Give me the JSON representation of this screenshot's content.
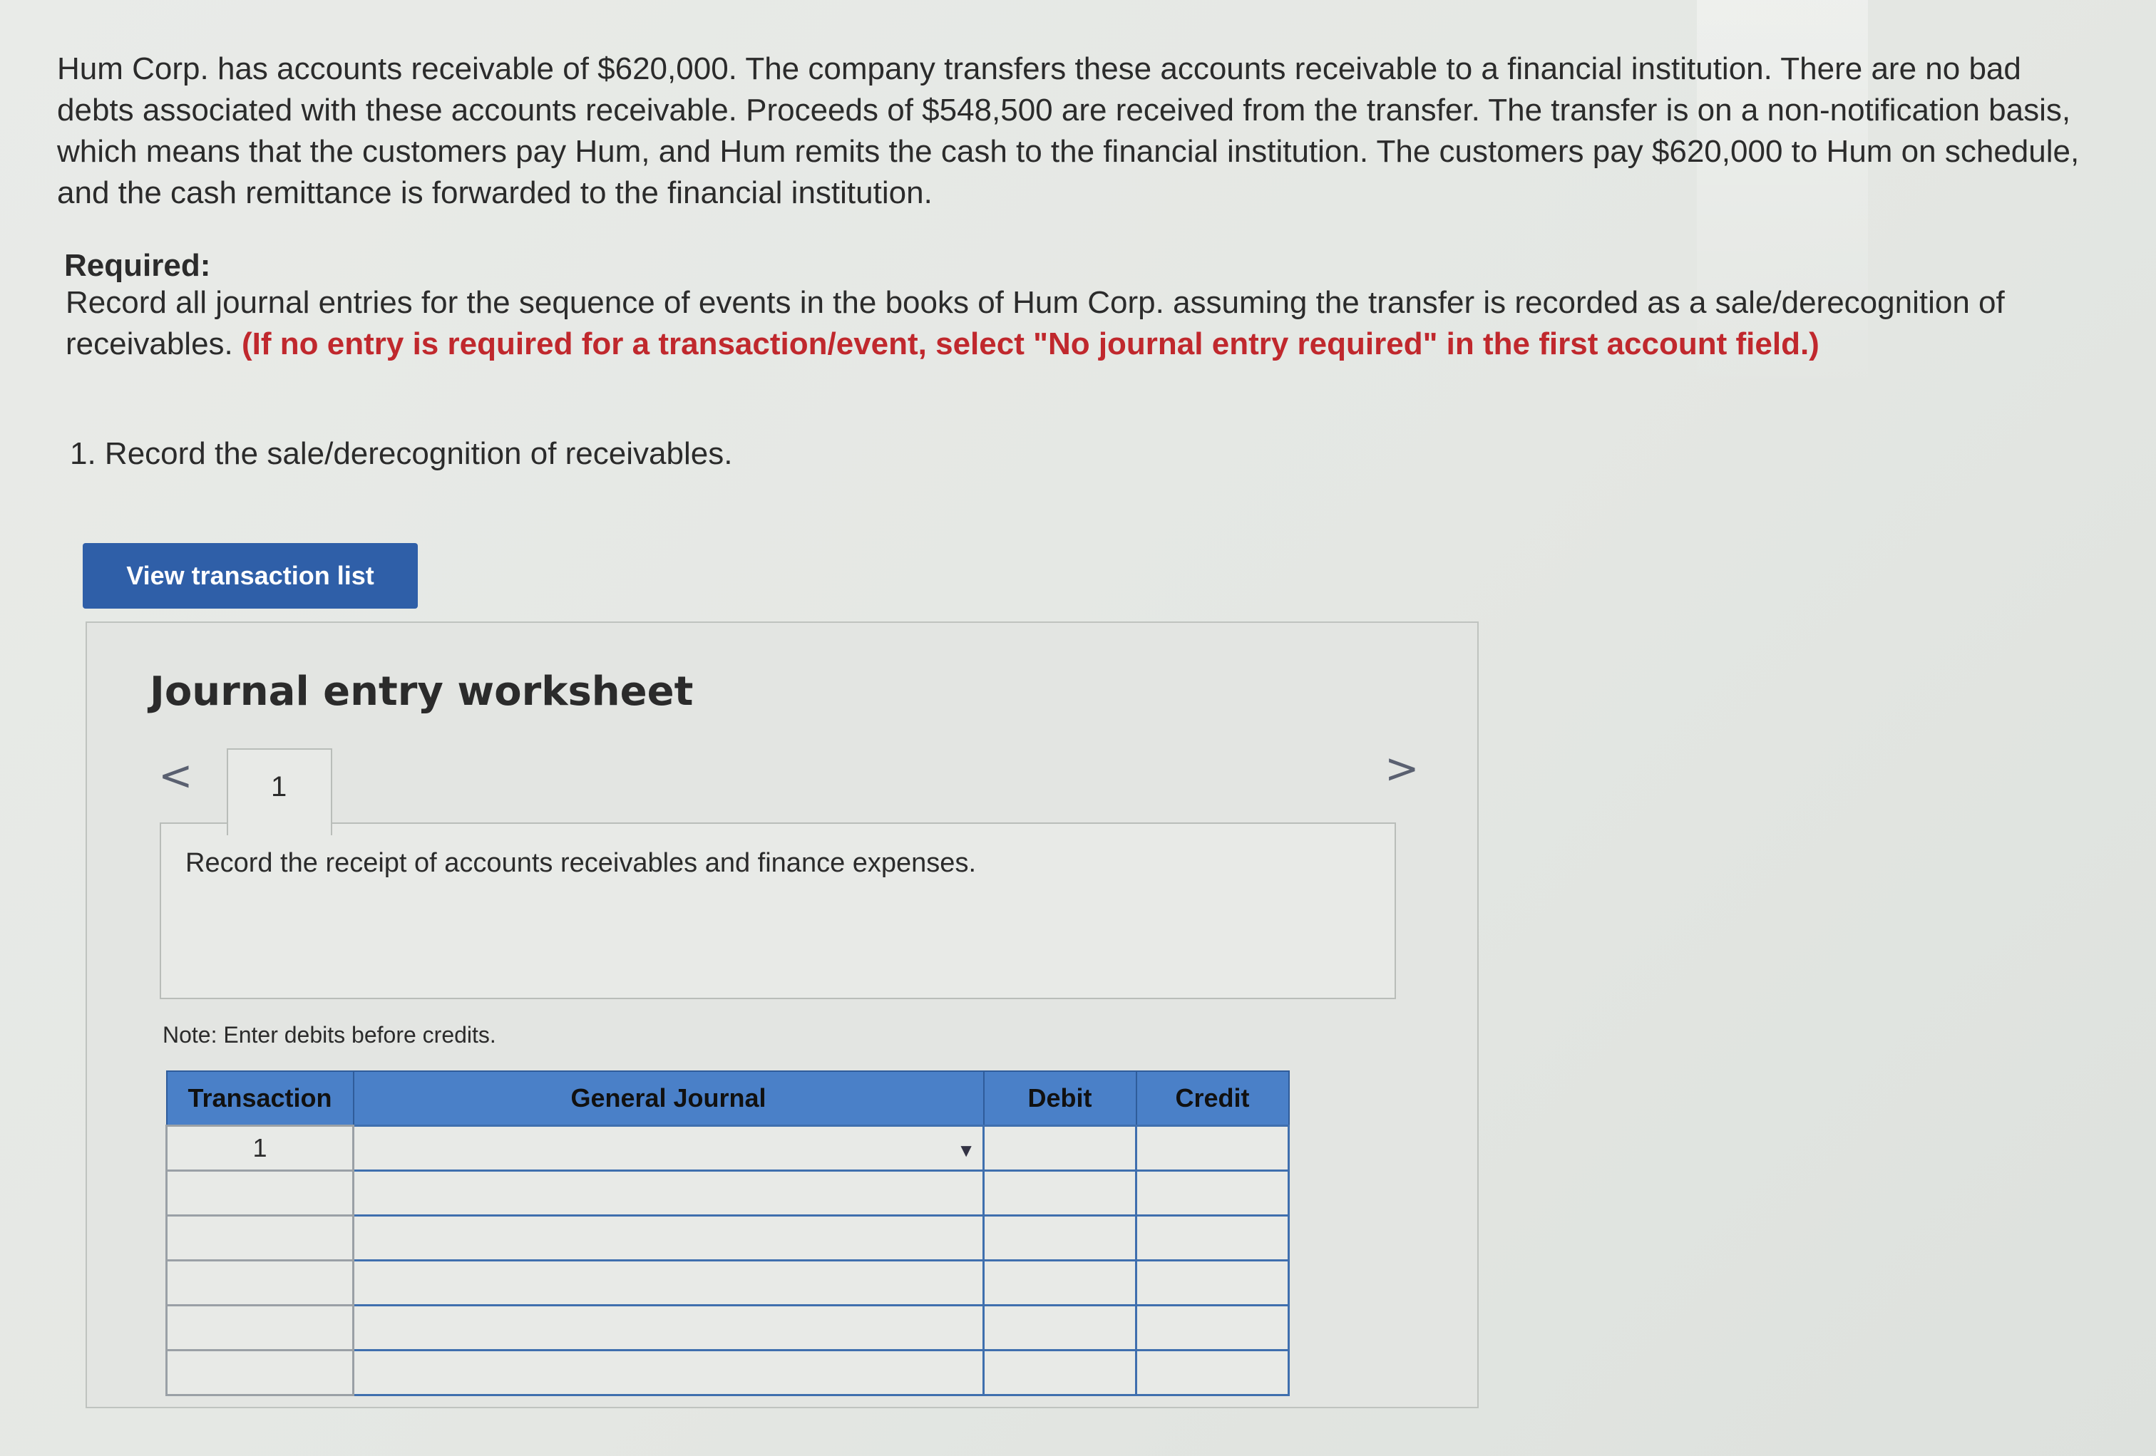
{
  "problem": {
    "text": "Hum Corp. has accounts receivable of $620,000. The company transfers these accounts receivable to a financial institution. There are no bad debts associated with these accounts receivable. Proceeds of $548,500 are received from the transfer. The transfer is on a non-notification basis, which means that the customers pay Hum, and Hum remits the cash to the financial institution. The customers pay $620,000 to Hum on schedule, and the cash remittance is forwarded to the financial institution."
  },
  "required": {
    "title": "Required:",
    "text": "Record all journal entries for the sequence of events in the books of Hum Corp. assuming the transfer is recorded as a sale/derecognition of receivables.",
    "note": "(If no entry is required for a transaction/event, select \"No journal entry required\" in the first account field.)"
  },
  "step": {
    "label": "1. Record the sale/derecognition of receivables."
  },
  "buttons": {
    "view_transaction_list": "View transaction list"
  },
  "worksheet": {
    "title": "Journal entry worksheet",
    "prev_symbol": "<",
    "next_symbol": ">",
    "active_tab": "1",
    "instruction": "Record the receipt of accounts receivables and finance expenses.",
    "note": "Note: Enter debits before credits.",
    "dropdown_symbol": "▼",
    "table": {
      "headers": [
        "Transaction",
        "General Journal",
        "Debit",
        "Credit"
      ],
      "rows": [
        {
          "transaction": "1",
          "account": "",
          "debit": "",
          "credit": ""
        },
        {
          "transaction": "",
          "account": "",
          "debit": "",
          "credit": ""
        },
        {
          "transaction": "",
          "account": "",
          "debit": "",
          "credit": ""
        },
        {
          "transaction": "",
          "account": "",
          "debit": "",
          "credit": ""
        },
        {
          "transaction": "",
          "account": "",
          "debit": "",
          "credit": ""
        },
        {
          "transaction": "",
          "account": "",
          "debit": "",
          "credit": ""
        }
      ]
    }
  },
  "colors": {
    "button_blue": "#2f5fa8",
    "header_blue": "#4a80c8",
    "required_red": "#c0282d"
  }
}
